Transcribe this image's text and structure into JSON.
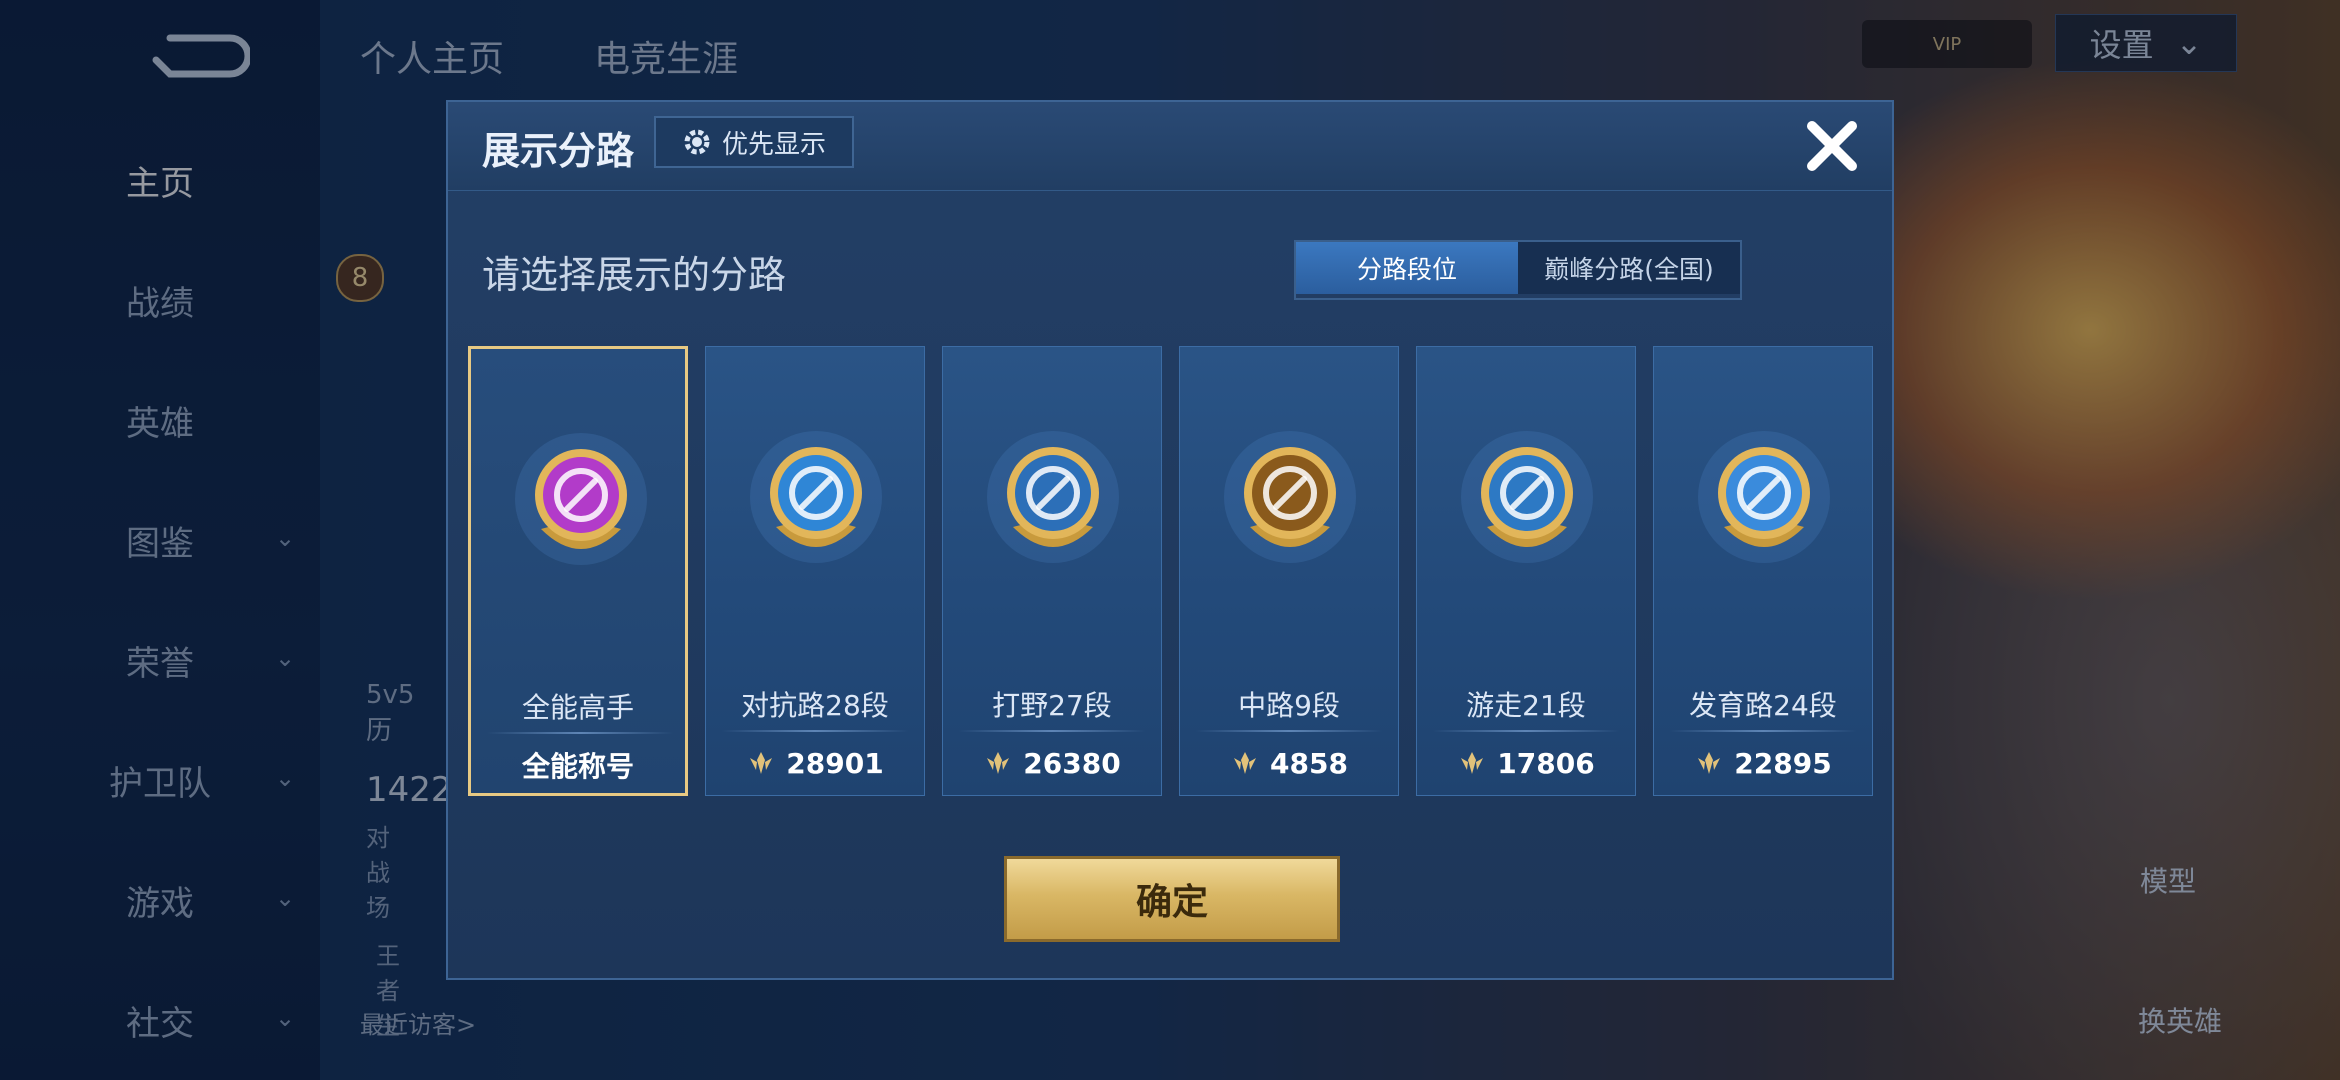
{
  "background": {
    "top_tabs": [
      "个人主页",
      "电竞生涯"
    ],
    "vip_text": "VIP",
    "settings_label": "设置",
    "sidebar": [
      {
        "label": "主页",
        "active": true,
        "has_chevron": false
      },
      {
        "label": "战绩",
        "active": false,
        "has_chevron": false
      },
      {
        "label": "英雄",
        "active": false,
        "has_chevron": false
      },
      {
        "label": "图鉴",
        "active": false,
        "has_chevron": true
      },
      {
        "label": "荣誉",
        "active": false,
        "has_chevron": true
      },
      {
        "label": "护卫队",
        "active": false,
        "has_chevron": true
      },
      {
        "label": "游戏",
        "active": false,
        "has_chevron": true
      },
      {
        "label": "社交",
        "active": false,
        "has_chevron": true
      }
    ],
    "level_badge": "8",
    "history_label": "5v5历",
    "count_partial": "1422",
    "battle_label": "对战场",
    "king_label": "王者生",
    "recent_visitors": "最近访客>",
    "model_button": "模型",
    "swap_hero_button": "换英雄"
  },
  "modal": {
    "title": "展示分路",
    "priority_button": "优先显示",
    "subtitle": "请选择展示的分路",
    "tabs": [
      {
        "label": "分路段位",
        "active": true
      },
      {
        "label": "巅峰分路(全国)",
        "active": false
      }
    ],
    "cards": [
      {
        "title": "全能高手",
        "footer": "全能称号",
        "has_score_icon": false,
        "selected": true,
        "color": "#b23bc9",
        "icon": "diamond-grid-icon"
      },
      {
        "title": "对抗路28段",
        "footer": "28901",
        "has_score_icon": true,
        "selected": false,
        "color": "#2f86d6",
        "icon": "crossed-swords-icon"
      },
      {
        "title": "打野27段",
        "footer": "26380",
        "has_score_icon": true,
        "selected": false,
        "color": "#2c6fb8",
        "icon": "dragon-icon"
      },
      {
        "title": "中路9段",
        "footer": "4858",
        "has_score_icon": true,
        "selected": false,
        "color": "#8a5a1c",
        "icon": "wand-icon"
      },
      {
        "title": "游走21段",
        "footer": "17806",
        "has_score_icon": true,
        "selected": false,
        "color": "#2d79c4",
        "icon": "wings-icon"
      },
      {
        "title": "发育路24段",
        "footer": "22895",
        "has_score_icon": true,
        "selected": false,
        "color": "#3a8bdc",
        "icon": "target-icon"
      }
    ],
    "confirm_button": "确定",
    "close_icon": "close-icon"
  }
}
